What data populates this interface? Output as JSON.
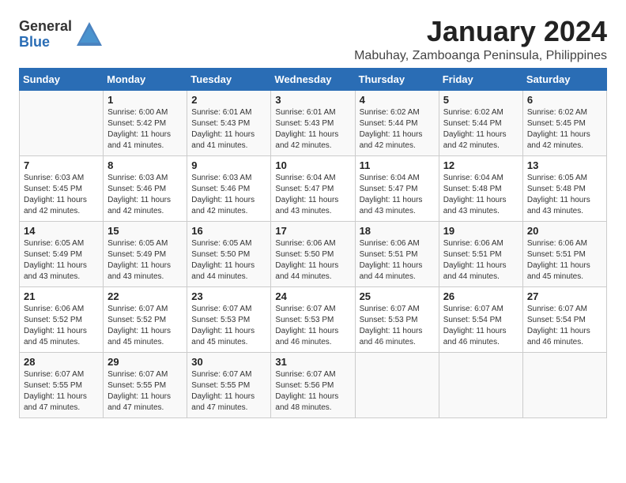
{
  "logo": {
    "general": "General",
    "blue": "Blue"
  },
  "title": "January 2024",
  "subtitle": "Mabuhay, Zamboanga Peninsula, Philippines",
  "days_header": [
    "Sunday",
    "Monday",
    "Tuesday",
    "Wednesday",
    "Thursday",
    "Friday",
    "Saturday"
  ],
  "weeks": [
    [
      {
        "day": "",
        "info": ""
      },
      {
        "day": "1",
        "info": "Sunrise: 6:00 AM\nSunset: 5:42 PM\nDaylight: 11 hours\nand 41 minutes."
      },
      {
        "day": "2",
        "info": "Sunrise: 6:01 AM\nSunset: 5:43 PM\nDaylight: 11 hours\nand 41 minutes."
      },
      {
        "day": "3",
        "info": "Sunrise: 6:01 AM\nSunset: 5:43 PM\nDaylight: 11 hours\nand 42 minutes."
      },
      {
        "day": "4",
        "info": "Sunrise: 6:02 AM\nSunset: 5:44 PM\nDaylight: 11 hours\nand 42 minutes."
      },
      {
        "day": "5",
        "info": "Sunrise: 6:02 AM\nSunset: 5:44 PM\nDaylight: 11 hours\nand 42 minutes."
      },
      {
        "day": "6",
        "info": "Sunrise: 6:02 AM\nSunset: 5:45 PM\nDaylight: 11 hours\nand 42 minutes."
      }
    ],
    [
      {
        "day": "7",
        "info": "Sunrise: 6:03 AM\nSunset: 5:45 PM\nDaylight: 11 hours\nand 42 minutes."
      },
      {
        "day": "8",
        "info": "Sunrise: 6:03 AM\nSunset: 5:46 PM\nDaylight: 11 hours\nand 42 minutes."
      },
      {
        "day": "9",
        "info": "Sunrise: 6:03 AM\nSunset: 5:46 PM\nDaylight: 11 hours\nand 42 minutes."
      },
      {
        "day": "10",
        "info": "Sunrise: 6:04 AM\nSunset: 5:47 PM\nDaylight: 11 hours\nand 43 minutes."
      },
      {
        "day": "11",
        "info": "Sunrise: 6:04 AM\nSunset: 5:47 PM\nDaylight: 11 hours\nand 43 minutes."
      },
      {
        "day": "12",
        "info": "Sunrise: 6:04 AM\nSunset: 5:48 PM\nDaylight: 11 hours\nand 43 minutes."
      },
      {
        "day": "13",
        "info": "Sunrise: 6:05 AM\nSunset: 5:48 PM\nDaylight: 11 hours\nand 43 minutes."
      }
    ],
    [
      {
        "day": "14",
        "info": "Sunrise: 6:05 AM\nSunset: 5:49 PM\nDaylight: 11 hours\nand 43 minutes."
      },
      {
        "day": "15",
        "info": "Sunrise: 6:05 AM\nSunset: 5:49 PM\nDaylight: 11 hours\nand 43 minutes."
      },
      {
        "day": "16",
        "info": "Sunrise: 6:05 AM\nSunset: 5:50 PM\nDaylight: 11 hours\nand 44 minutes."
      },
      {
        "day": "17",
        "info": "Sunrise: 6:06 AM\nSunset: 5:50 PM\nDaylight: 11 hours\nand 44 minutes."
      },
      {
        "day": "18",
        "info": "Sunrise: 6:06 AM\nSunset: 5:51 PM\nDaylight: 11 hours\nand 44 minutes."
      },
      {
        "day": "19",
        "info": "Sunrise: 6:06 AM\nSunset: 5:51 PM\nDaylight: 11 hours\nand 44 minutes."
      },
      {
        "day": "20",
        "info": "Sunrise: 6:06 AM\nSunset: 5:51 PM\nDaylight: 11 hours\nand 45 minutes."
      }
    ],
    [
      {
        "day": "21",
        "info": "Sunrise: 6:06 AM\nSunset: 5:52 PM\nDaylight: 11 hours\nand 45 minutes."
      },
      {
        "day": "22",
        "info": "Sunrise: 6:07 AM\nSunset: 5:52 PM\nDaylight: 11 hours\nand 45 minutes."
      },
      {
        "day": "23",
        "info": "Sunrise: 6:07 AM\nSunset: 5:53 PM\nDaylight: 11 hours\nand 45 minutes."
      },
      {
        "day": "24",
        "info": "Sunrise: 6:07 AM\nSunset: 5:53 PM\nDaylight: 11 hours\nand 46 minutes."
      },
      {
        "day": "25",
        "info": "Sunrise: 6:07 AM\nSunset: 5:53 PM\nDaylight: 11 hours\nand 46 minutes."
      },
      {
        "day": "26",
        "info": "Sunrise: 6:07 AM\nSunset: 5:54 PM\nDaylight: 11 hours\nand 46 minutes."
      },
      {
        "day": "27",
        "info": "Sunrise: 6:07 AM\nSunset: 5:54 PM\nDaylight: 11 hours\nand 46 minutes."
      }
    ],
    [
      {
        "day": "28",
        "info": "Sunrise: 6:07 AM\nSunset: 5:55 PM\nDaylight: 11 hours\nand 47 minutes."
      },
      {
        "day": "29",
        "info": "Sunrise: 6:07 AM\nSunset: 5:55 PM\nDaylight: 11 hours\nand 47 minutes."
      },
      {
        "day": "30",
        "info": "Sunrise: 6:07 AM\nSunset: 5:55 PM\nDaylight: 11 hours\nand 47 minutes."
      },
      {
        "day": "31",
        "info": "Sunrise: 6:07 AM\nSunset: 5:56 PM\nDaylight: 11 hours\nand 48 minutes."
      },
      {
        "day": "",
        "info": ""
      },
      {
        "day": "",
        "info": ""
      },
      {
        "day": "",
        "info": ""
      }
    ]
  ]
}
